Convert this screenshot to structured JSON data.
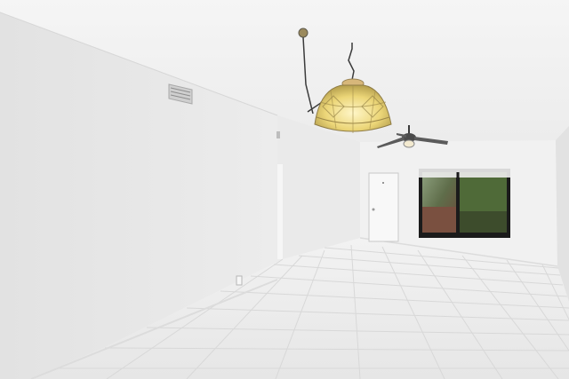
{
  "scene": {
    "type": "empty interior room",
    "colors": {
      "ceiling": "#f3f3f3",
      "left_wall": "#e8e8e8",
      "back_wall": "#f0f0f0",
      "right_wall": "#e4e4e4",
      "floor_tile": "#ededed",
      "grout": "#d9d9d9",
      "lamp_glass": "#e8d57a",
      "window_frame": "#1b1b1b"
    }
  },
  "elements": [
    {
      "name": "ceiling",
      "kind": "surface"
    },
    {
      "name": "left-wall",
      "kind": "surface"
    },
    {
      "name": "hallway-wall",
      "kind": "surface"
    },
    {
      "name": "back-wall",
      "kind": "surface"
    },
    {
      "name": "right-wall",
      "kind": "surface"
    },
    {
      "name": "tile-floor",
      "kind": "surface"
    },
    {
      "name": "air-vent-icon",
      "kind": "fixture"
    },
    {
      "name": "pendant-lamp-icon",
      "kind": "fixture"
    },
    {
      "name": "ceiling-fan-icon",
      "kind": "fixture"
    },
    {
      "name": "white-door",
      "kind": "fixture"
    },
    {
      "name": "window",
      "kind": "fixture"
    },
    {
      "name": "light-switch-icon",
      "kind": "fixture"
    }
  ]
}
